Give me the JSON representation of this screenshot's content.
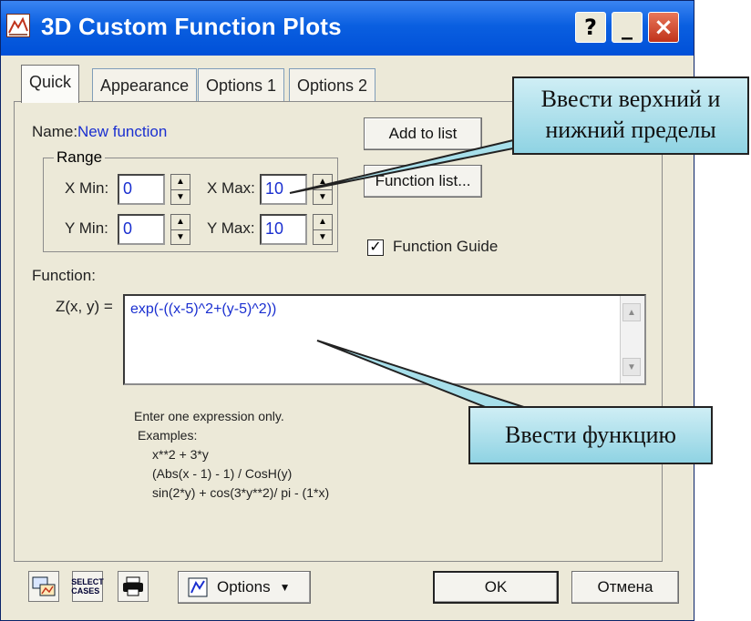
{
  "window": {
    "title": "3D Custom Function Plots"
  },
  "titlebar_buttons": {
    "help": "?",
    "minimize": "_",
    "close": "×"
  },
  "tabs": [
    {
      "label": "Quick"
    },
    {
      "label": "Appearance"
    },
    {
      "label": "Options 1"
    },
    {
      "label": "Options 2"
    }
  ],
  "name_row": {
    "label": "Name:",
    "value": "New function"
  },
  "range": {
    "title": "Range",
    "x_min_label": "X Min:",
    "x_min": "0",
    "x_max_label": "X Max:",
    "x_max": "10",
    "y_min_label": "Y Min:",
    "y_min": "0",
    "y_max_label": "Y Max:",
    "y_max": "10"
  },
  "buttons": {
    "add_to_list": "Add to list",
    "function_list": "Function list...",
    "ok": "OK",
    "cancel": "Отмена",
    "options": "Options"
  },
  "function_guide": {
    "label": "Function Guide",
    "checked": true
  },
  "function": {
    "label": "Function:",
    "z_label": "Z(x, y) =",
    "expression": "exp(-((x-5)^2+(y-5)^2))"
  },
  "hints": {
    "line1": "Enter one expression only.",
    "line2": "Examples:",
    "ex1": "x**2 + 3*y",
    "ex2": "(Abs(x - 1) - 1) / CosH(y)",
    "ex3": "sin(2*y) + cos(3*y**2)/ pi - (1*x)"
  },
  "bottom_icons": {
    "graph": "graph-icon",
    "select_cases": "SELECT CASES",
    "printer": "printer-icon",
    "options_icon": "chart-options-icon"
  },
  "callouts": {
    "limits": "Ввести верхний и нижний пределы",
    "function": "Ввести функцию"
  }
}
